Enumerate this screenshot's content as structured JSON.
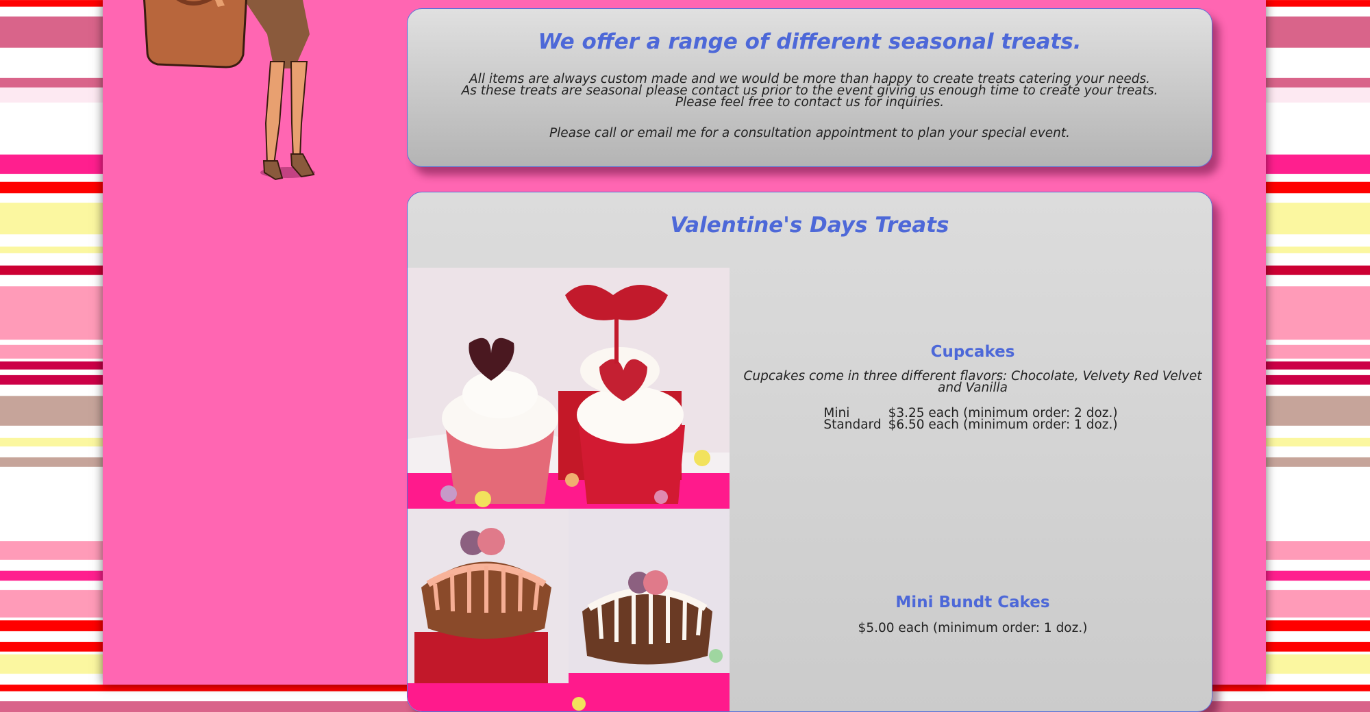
{
  "intro_panel": {
    "heading": "We offer a range of different seasonal treats.",
    "lines": [
      "All items are always custom made and we would be more than happy to create treats catering your needs.",
      "As these treats are seasonal please contact us prior to the event giving us enough time to create your treats.",
      "Please feel free to contact us for inquiries."
    ],
    "cta": "Please call or email me for a consultation appointment to plan your special event."
  },
  "valentines_panel": {
    "heading": "Valentine's Days Treats",
    "items": [
      {
        "title": "Cupcakes",
        "description": "Cupcakes come in three different flavors: Chocolate, Velvety Red Velvet and Vanilla",
        "prices": [
          {
            "size": "Mini",
            "price": "$3.25 each",
            "minimum": "(minimum order: 2 doz.)"
          },
          {
            "size": "Standard",
            "price": "$6.50 each",
            "minimum": "(minimum order: 1 doz.)"
          }
        ]
      },
      {
        "title": "Mini Bundt Cakes",
        "price": "$5.00 each",
        "minimum": "(minimum order: 1 doz.)"
      }
    ]
  },
  "colors": {
    "page_background": "#ff66b2",
    "heading_blue": "#4d68d8",
    "panel_border": "#5870d8"
  }
}
